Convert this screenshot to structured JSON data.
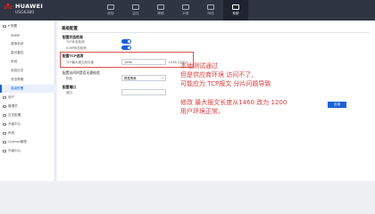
{
  "header": {
    "brand": "HUAWEI",
    "model": "USG6380",
    "nav": [
      {
        "label": "面板",
        "icon": "dashboard-icon"
      },
      {
        "label": "监控",
        "icon": "monitor-icon"
      },
      {
        "label": "策略",
        "icon": "policy-icon"
      },
      {
        "label": "对象",
        "icon": "object-icon"
      },
      {
        "label": "网络",
        "icon": "network-icon"
      },
      {
        "label": "系统",
        "icon": "system-icon",
        "active": true
      }
    ]
  },
  "sidebar": {
    "items": [
      {
        "label": "▾ 配置",
        "icon": "settings-icon"
      },
      {
        "label": "SNMP"
      },
      {
        "label": "虚拟系统",
        "icon": "system-icon"
      },
      {
        "label": "高可靠性"
      },
      {
        "label": "系统"
      },
      {
        "label": "系统日志"
      },
      {
        "label": "安全策略"
      },
      {
        "label": "高级配置",
        "active": true
      },
      {
        "label": "用户",
        "icon": "user-icon"
      },
      {
        "label": "管理员",
        "icon": "admin-icon"
      },
      {
        "label": "日志配置",
        "icon": "log-icon"
      },
      {
        "label": "升级中心",
        "icon": "upgrade-icon"
      },
      {
        "label": "系统",
        "icon": "system-icon"
      },
      {
        "label": "License管理",
        "icon": "license-icon"
      },
      {
        "label": "升级中心",
        "icon": "upgrade-icon"
      }
    ]
  },
  "main": {
    "title": "高级配置",
    "sec1_title": "配置状态检测",
    "sec1_row1_label": "TCP状态检测",
    "sec1_row2_label": "ICMP状态检测",
    "tcp_title": "配置TCP选项",
    "tcp_label": "TCP最大报文段长度",
    "tcp_value": "1200",
    "tcp_hint": "<536-1460>",
    "sec3_title": "配置访问时是否无需校验",
    "sec3_label": "校验",
    "sec3_select": "根据策略",
    "sec4_title": "配置端口",
    "sec4_label": "端口",
    "sec4_value": "",
    "apply_label": "应用"
  },
  "notes": {
    "note1_line1": "本地测试通过",
    "note1_line2": "但是供应商环境 访问不了,",
    "note1_line3": "可能应为 TCP报文 分片问题导致",
    "note2_line1": "修改 最大报文长度从1460 改为 1200",
    "note2_line2": "用户环境正常。"
  },
  "colors": {
    "accent": "#1a62d9",
    "header_bg": "#2f3542",
    "annotation_red": "#d93a3a"
  }
}
